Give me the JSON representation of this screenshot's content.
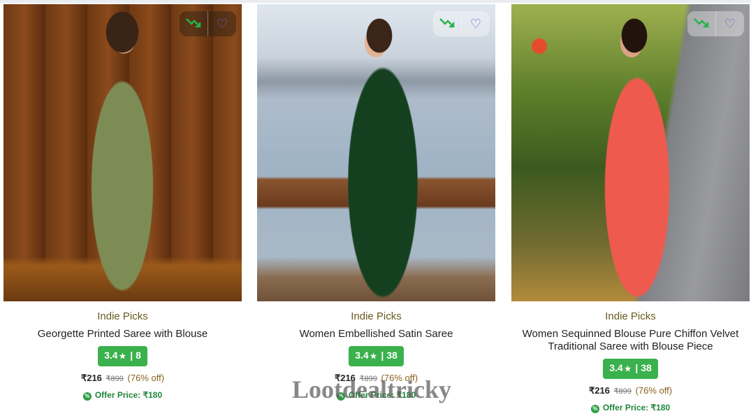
{
  "products": [
    {
      "brand": "Indie Picks",
      "title": "Georgette Printed Saree with Blouse",
      "rating": "3.4",
      "rating_count": "8",
      "price": "₹216",
      "mrp": "₹899",
      "discount": "(76% off)",
      "offer_price": "Offer Price: ₹180",
      "image_alt": "woman in olive green printed saree"
    },
    {
      "brand": "Indie Picks",
      "title": "Women Embellished Satin Saree",
      "rating": "3.4",
      "rating_count": "38",
      "price": "₹216",
      "mrp": "₹899",
      "discount": "(76% off)",
      "offer_price": "Offer Price: ₹180",
      "image_alt": "woman in dark green satin saree on a boat"
    },
    {
      "brand": "Indie Picks",
      "title": "Women Sequinned Blouse Pure Chiffon Velvet Traditional Saree with Blouse Piece",
      "rating": "3.4",
      "rating_count": "38",
      "price": "₹216",
      "mrp": "₹899",
      "discount": "(76% off)",
      "offer_price": "Offer Price: ₹180",
      "image_alt": "woman in coral red chiffon saree on a road"
    }
  ],
  "icons": {
    "price_trend": "trending-down-icon",
    "wishlist": "heart-icon",
    "offer": "percent-badge-icon"
  },
  "colors": {
    "rating_badge": "#3ab14c",
    "offer_text": "#20873a",
    "brand_text": "#6b5a1e",
    "wishlist_icon": "#7a5cc9"
  },
  "watermark": "Lootdealtricky"
}
